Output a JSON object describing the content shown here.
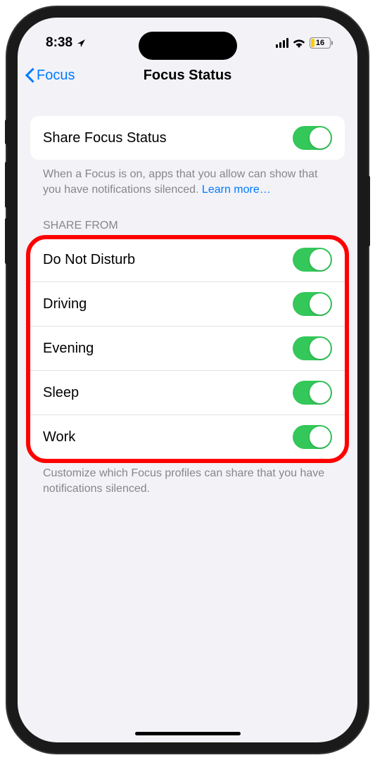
{
  "status_bar": {
    "time": "8:38",
    "battery_level": "16"
  },
  "nav": {
    "back_label": "Focus",
    "title": "Focus Status"
  },
  "share_toggle": {
    "label": "Share Focus Status",
    "footer": "When a Focus is on, apps that you allow can show that you have notifications silenced. ",
    "learn_more": "Learn more…"
  },
  "share_from": {
    "header": "Share From",
    "items": [
      {
        "label": "Do Not Disturb"
      },
      {
        "label": "Driving"
      },
      {
        "label": "Evening"
      },
      {
        "label": "Sleep"
      },
      {
        "label": "Work"
      }
    ],
    "footer": "Customize which Focus profiles can share that you have notifications silenced."
  }
}
